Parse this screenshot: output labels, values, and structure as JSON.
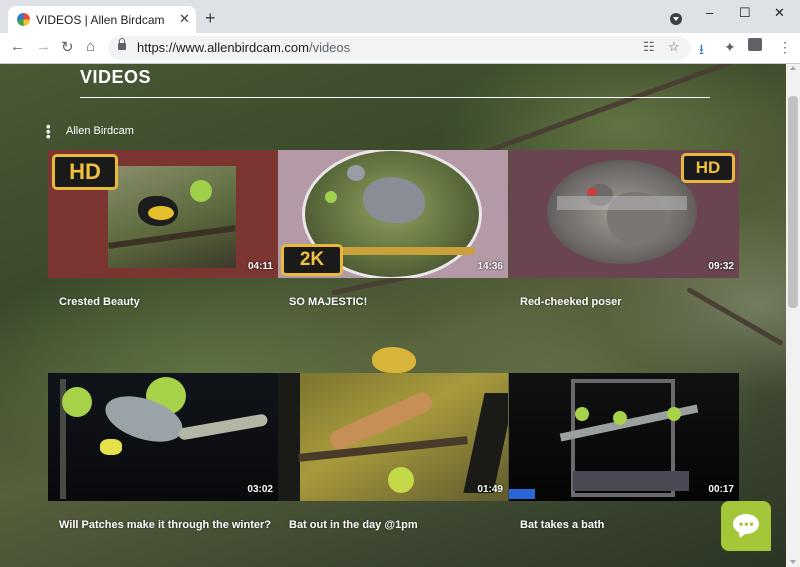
{
  "browser": {
    "tab_title": "VIDEOS | Allen Birdcam",
    "tab_close": "✕",
    "new_tab": "+",
    "url_host": "https://www.allenbirdcam.com",
    "url_path": "/videos",
    "window_controls": [
      "–",
      "☐",
      "✕"
    ],
    "nav_icons": [
      "arrow-left-icon",
      "arrow-right-icon",
      "reload-icon",
      "home-icon"
    ]
  },
  "page": {
    "section_title": "VIDEOS",
    "channel_name": "Allen Birdcam",
    "accent_color": "#a4c639",
    "videos": [
      {
        "title": "Crested Beauty",
        "duration": "04:11",
        "badge": "HD",
        "bg": "#7c3631"
      },
      {
        "title": "SO MAJESTIC!",
        "duration": "14:36",
        "badge": "2K",
        "bg": "#b49aa7"
      },
      {
        "title": "Red-cheeked poser",
        "duration": "09:32",
        "badge": "HD",
        "bg": "#6a4451"
      },
      {
        "title": "Will Patches make it through the winter?",
        "duration": "03:02",
        "badge": "",
        "bg": "#0d0d10"
      },
      {
        "title": "Bat out in the day @1pm",
        "duration": "01:49",
        "badge": "",
        "bg": "#e0b830"
      },
      {
        "title": "Bat takes a bath",
        "duration": "00:17",
        "badge": "",
        "bg": "#070707"
      }
    ]
  }
}
